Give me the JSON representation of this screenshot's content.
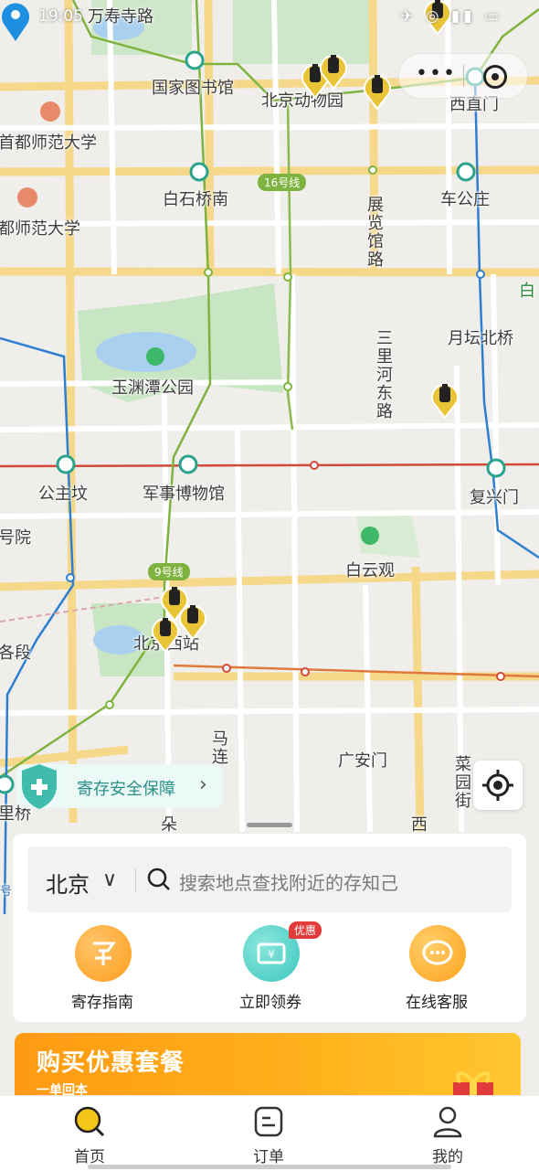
{
  "status_bar": {
    "time": "19:05",
    "icons": "✈ ◎ ▮▮ ▭"
  },
  "map": {
    "places": {
      "wanshousi": "万寿寺路",
      "guojiatushuguan": "国家图书馆",
      "beijingdongwuyuan": "北京动物园",
      "xizhimen": "西直门",
      "shoushi1": "首都师范大学",
      "shoushi2": "都师范大学",
      "baishiqiaonan": "白石桥南",
      "line16": "16号线",
      "chegongzhuang": "车公庄",
      "zhanlanguanlu": "展览馆路",
      "bai": "白",
      "yuetanbeiqiao": "月坛北桥",
      "sanlihedonglu": "三里河东路",
      "yuyuantan": "玉渊潭公园",
      "gongzhufen": "公主坟",
      "junshibowuguan": "军事博物馆",
      "fuxingmen": "复兴门",
      "haoyuan": "号院",
      "baiyunguan": "白云观",
      "line9": "9号线",
      "beijingxizhan": "北京西站",
      "geduan": "各段",
      "ma": "马连",
      "guanganmen": "广安门",
      "caiyuanjie": "菜园街",
      "liqiao": "里桥",
      "xi": "西",
      "lu": "朵",
      "hao": "号"
    }
  },
  "capsule": {
    "more_icon": "more-dots-icon",
    "close_icon": "close-circle-icon",
    "dots": "•••"
  },
  "safety": {
    "label": "寄存安全保障",
    "chevron": "›"
  },
  "search": {
    "city": "北京",
    "city_chevron": "∨",
    "placeholder": "搜索地点查找附近的存知己"
  },
  "quick_actions": [
    {
      "label": "寄存指南",
      "color": "#ff9d1c"
    },
    {
      "label": "立即领券",
      "color": "#3cc8c0",
      "badge": "优惠"
    },
    {
      "label": "在线客服",
      "color": "#ffa21a"
    }
  ],
  "banner": {
    "title": "购买优惠套餐",
    "subtitle": "一单回本"
  },
  "tabbar": [
    {
      "label": "首页",
      "icon": "home-search-icon"
    },
    {
      "label": "订单",
      "icon": "order-icon"
    },
    {
      "label": "我的",
      "icon": "profile-icon"
    }
  ],
  "colors": {
    "accent": "#2a8f86",
    "pin_yellow": "#e9c437",
    "metro_green": "#7fb33f",
    "metro_red": "#d14a3a",
    "metro_blue": "#2f7fd1"
  }
}
